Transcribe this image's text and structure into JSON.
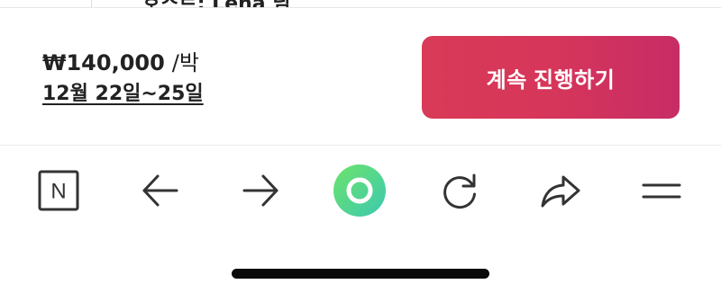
{
  "previous_content": {
    "cut_text": "호스트: Lena 님"
  },
  "booking": {
    "price": "₩140,000",
    "price_unit": "/박",
    "date_range": "12월 22일~25일",
    "continue_label": "계속 진행하기",
    "accent_color": "#d6365a"
  },
  "toolbar": {
    "items": [
      {
        "icon": "naver-n-icon",
        "glyph": "N"
      },
      {
        "icon": "back-arrow-icon"
      },
      {
        "icon": "forward-arrow-icon"
      },
      {
        "icon": "green-circle-home-icon"
      },
      {
        "icon": "reload-icon"
      },
      {
        "icon": "share-icon"
      },
      {
        "icon": "menu-icon"
      }
    ]
  }
}
